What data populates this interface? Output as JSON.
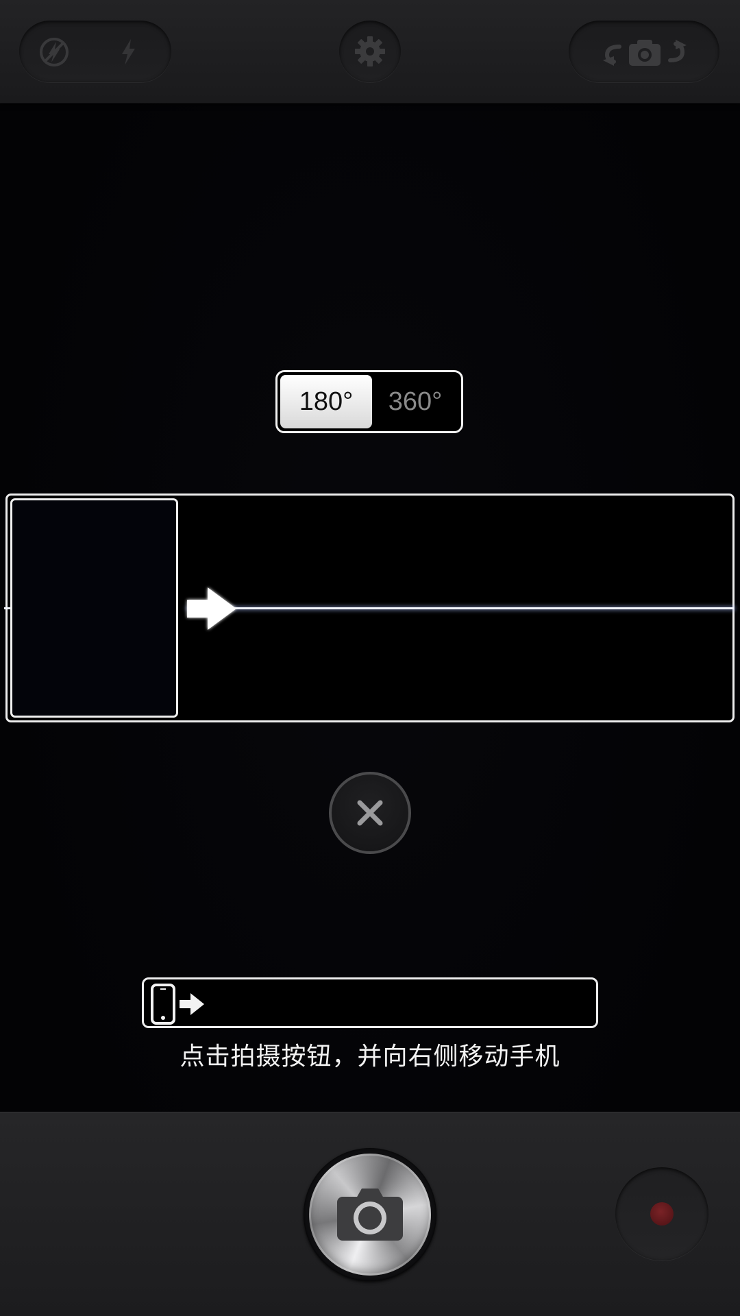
{
  "top_bar": {
    "flash_off_icon": "flash-off-icon",
    "flash_on_icon": "flash-icon",
    "settings_icon": "gear-icon",
    "switch_camera_icon": "switch-camera-icon"
  },
  "mode_toggle": {
    "options": [
      "180°",
      "360°"
    ],
    "selected": "180°"
  },
  "panorama": {
    "direction": "right"
  },
  "hint": {
    "text": "点击拍摄按钮，并向右侧移动手机"
  },
  "bottom_bar": {
    "shutter_icon": "camera-icon",
    "record_icon": "record-icon"
  },
  "colors": {
    "background": "#030305",
    "selected_segment": "#ffffff",
    "unselected_text": "#8a8a8a",
    "record_dot": "#6a1a1e"
  }
}
